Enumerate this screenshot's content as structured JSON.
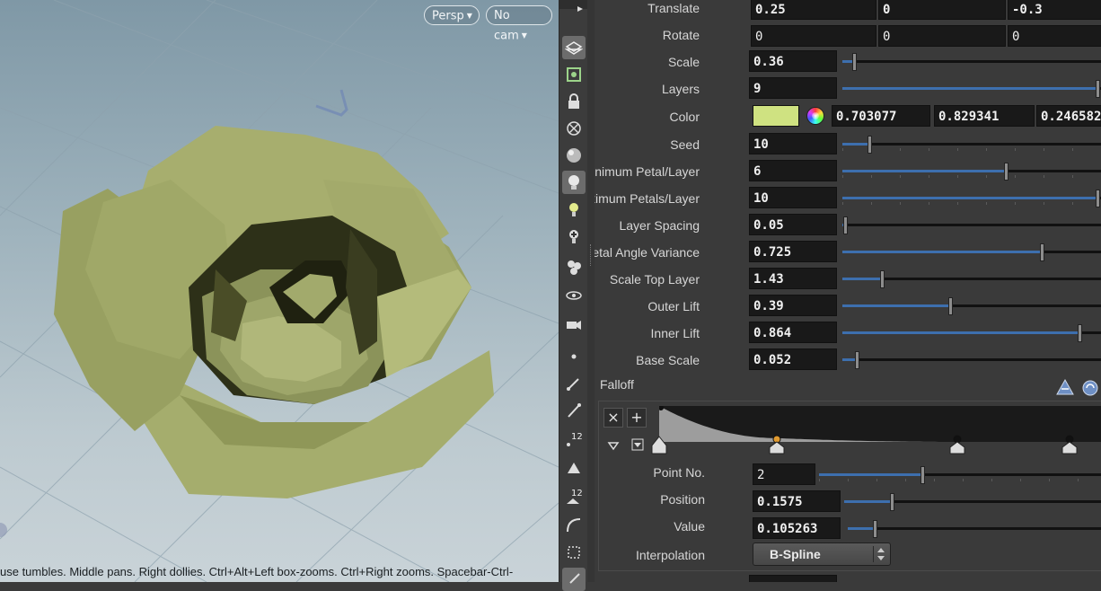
{
  "viewport": {
    "persp_label": "Persp",
    "cam_label": "No cam",
    "hint": "use tumbles. Middle pans. Right dollies. Ctrl+Alt+Left box-zooms. Ctrl+Right zooms. Spacebar-Ctrl-"
  },
  "params": {
    "translate": {
      "label": "Translate",
      "x": "0.25",
      "y": "0",
      "z": "-0.3"
    },
    "rotate": {
      "label": "Rotate",
      "x": "0",
      "y": "0",
      "z": "0"
    },
    "scale": {
      "label": "Scale",
      "value": "0.36",
      "level": 0.04
    },
    "layers": {
      "label": "Layers",
      "value": "9",
      "level": 1.0
    },
    "color": {
      "label": "Color",
      "r": "0.703077",
      "g": "0.829341",
      "b": "0.246582",
      "swatch": "#cfe281"
    },
    "seed": {
      "label": "Seed",
      "value": "10",
      "level": 0.1
    },
    "min_petal": {
      "label": "Minimum Petal/Layer",
      "value": "6",
      "level": 0.64
    },
    "max_petals": {
      "label": "Maximum Petals/Layer",
      "value": "10",
      "level": 1.0
    },
    "layer_spacing": {
      "label": "Layer Spacing",
      "value": "0.05",
      "level": 0.005
    },
    "petal_angle": {
      "label": "Petal Angle Variance",
      "value": "0.725",
      "level": 0.78
    },
    "scale_top": {
      "label": "Scale Top Layer",
      "value": "1.43",
      "level": 0.15
    },
    "outer_lift": {
      "label": "Outer Lift",
      "value": "0.39",
      "level": 0.42
    },
    "inner_lift": {
      "label": "Inner Lift",
      "value": "0.864",
      "level": 0.93
    },
    "base_scale": {
      "label": "Base Scale",
      "value": "0.052",
      "level": 0.05
    }
  },
  "falloff": {
    "label": "Falloff",
    "remove_label": "×",
    "add_label": "+",
    "point_no": {
      "label": "Point No.",
      "value": "2",
      "level": 0.4
    },
    "position": {
      "label": "Position",
      "value": "0.1575",
      "level": 0.18
    },
    "value": {
      "label": "Value",
      "value": "0.105263",
      "level": 0.1
    },
    "interpolation": {
      "label": "Interpolation",
      "value": "B-Spline"
    },
    "ramp_keys": [
      0.0,
      0.1575,
      0.4,
      0.55
    ],
    "ramp_values": [
      1.0,
      0.105263,
      0.0,
      0.0
    ],
    "selected_key": 1
  },
  "colors": {
    "accent": "#3d6fae",
    "selected_key": "#e09a30",
    "petal": "#a3ab6a"
  }
}
